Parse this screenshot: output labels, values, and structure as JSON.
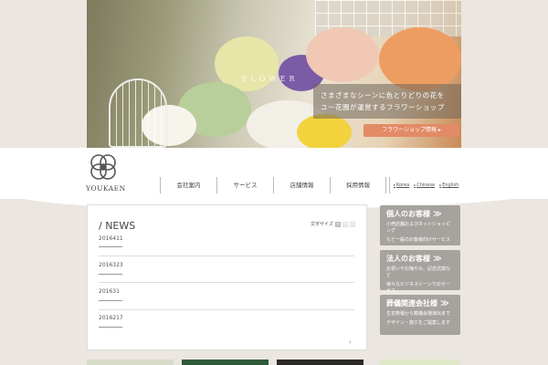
{
  "hero": {
    "label": "FLOWER",
    "copy_line1": "さまざまなシーンに色とりどりの花を",
    "copy_line2": "ユー花園が運営するフラワーショップ",
    "shop_button": "フラワーショップ情報 ▸"
  },
  "logo": {
    "text": "YOUKAEN"
  },
  "nav": {
    "items": [
      "会社案内",
      "サービス",
      "店舗情報",
      "採用情報"
    ],
    "languages": [
      "Korea",
      "Chinese",
      "English"
    ]
  },
  "news": {
    "title": "/ NEWS",
    "font_size_label": "文字サイズ",
    "font_size_options": [
      "大",
      "中",
      "小"
    ],
    "items": [
      "2016411",
      "2016323",
      "201631",
      "2016217"
    ]
  },
  "side_buttons": [
    {
      "title": "個人のお客様",
      "desc_line1": "小売店舗およびネットショッピング",
      "desc_line2": "など一般のお客様向けサービス"
    },
    {
      "title": "法人のお客様",
      "desc_line1": "お祝いやお悔やみ、記念式典など",
      "desc_line2": "様々なビジネスシーンでのサービス"
    },
    {
      "title": "葬儀関連会社様",
      "desc_line1": "生花祭壇から葬儀会場演出まで",
      "desc_line2": "デザイン・施工をご提案します"
    }
  ],
  "colors": {
    "accent": "#e38a66",
    "side_button": "#a6a39e",
    "background": "#ebe6df"
  }
}
